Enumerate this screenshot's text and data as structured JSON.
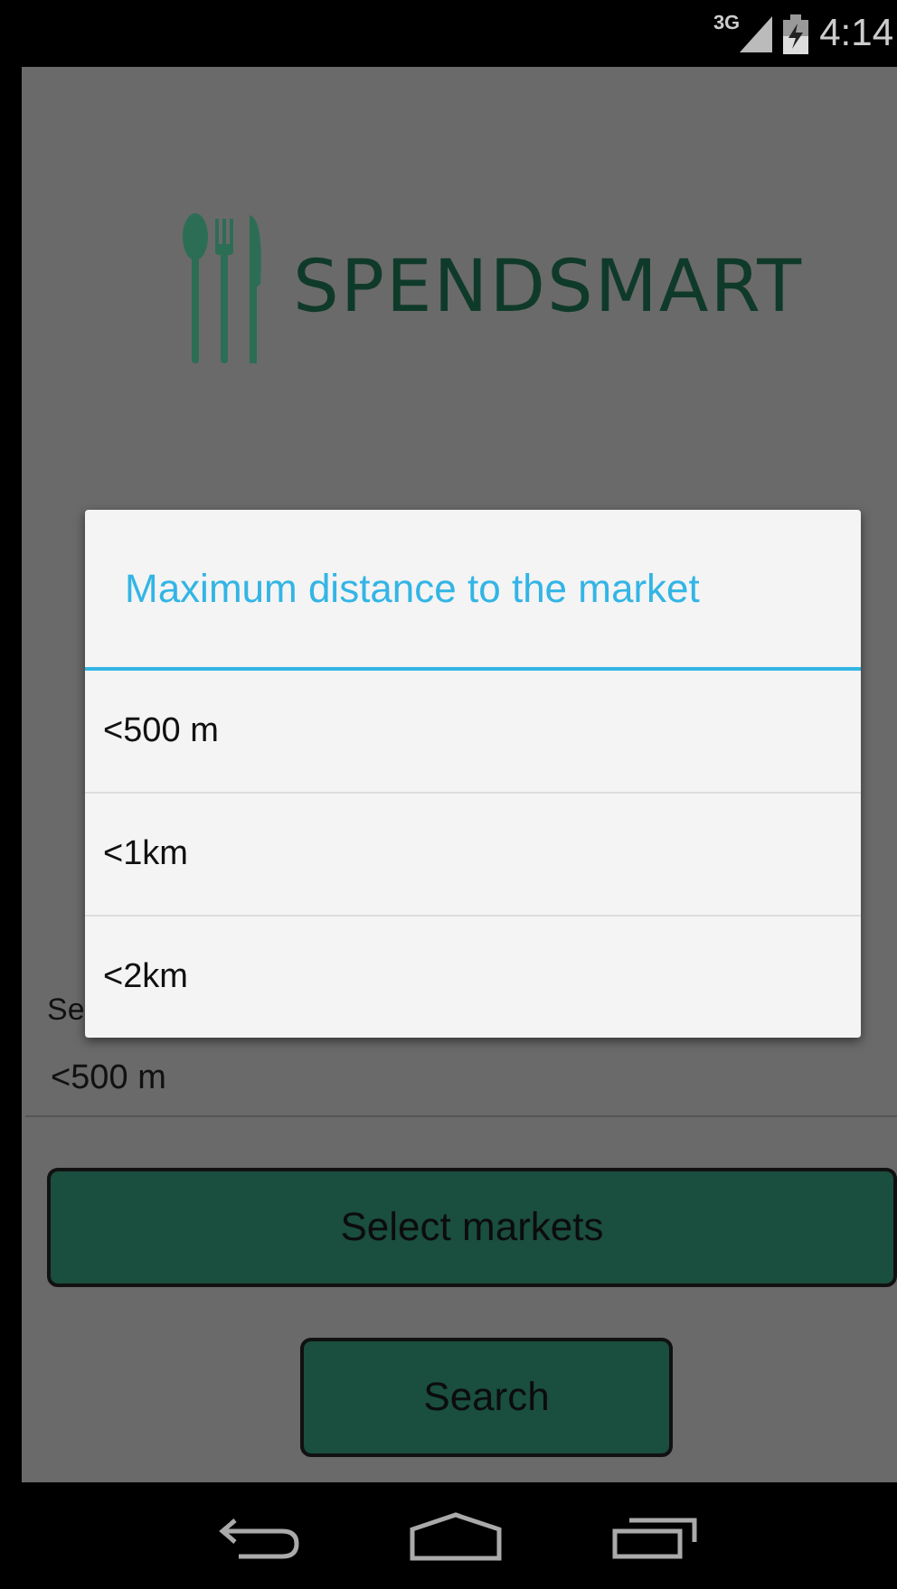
{
  "status_bar": {
    "network": "3G",
    "time": "4:14"
  },
  "logo": {
    "name": "SPENDSMART"
  },
  "distance": {
    "label": "Se",
    "value": "<500 m"
  },
  "buttons": [
    {
      "label": "Select markets",
      "kind": "wide"
    },
    {
      "label": "Search",
      "kind": "narrow"
    }
  ],
  "dialog": {
    "title": "Maximum distance to the market",
    "options": [
      {
        "label": "<500 m"
      },
      {
        "label": "<1km"
      },
      {
        "label": "<2km"
      }
    ]
  }
}
